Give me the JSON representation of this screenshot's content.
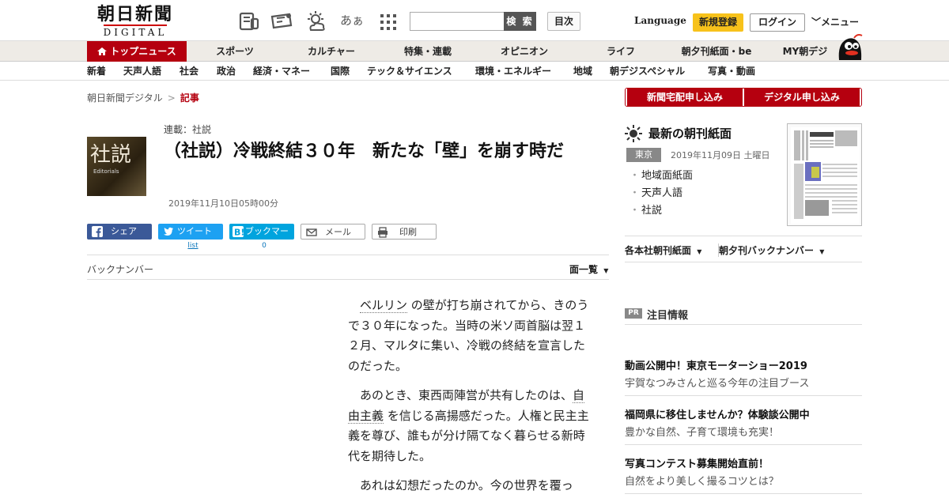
{
  "header": {
    "logo_kanji": "朝日新聞",
    "logo_latin": "DIGITAL",
    "search_button": "検 索",
    "toc_button": "目次",
    "language": "Language",
    "register": "新規登録",
    "login": "ログイン",
    "menu": "メニュー",
    "icons": [
      "newspaper-icon",
      "ticket-icon",
      "weather-icon",
      "font-size-icon",
      "grid-icon"
    ],
    "font_icon_text": "あぁ"
  },
  "nav_primary": [
    "トップニュース",
    "スポーツ",
    "カルチャー",
    "特集・連載",
    "オピニオン",
    "ライフ",
    "朝夕刊紙面・be",
    "MY朝デジ"
  ],
  "nav_secondary": [
    "新着",
    "天声人語",
    "社会",
    "政治",
    "経済・マネー",
    "国際",
    "テック＆サイエンス",
    "環境・エネルギー",
    "地域",
    "朝デジスペシャル",
    "写真・動画"
  ],
  "breadcrumb": {
    "home": "朝日新聞デジタル",
    "separator": ">",
    "current": "記事"
  },
  "article": {
    "thumb_main": "社説",
    "thumb_sub": "Editorials",
    "series": "連載：社説",
    "title": "（社説）冷戦終結３０年　新たな「壁」を崩す時だ",
    "date": "2019年11月10日05時00分",
    "back_number": "バックナンバー",
    "page_list": "面一覧",
    "paragraphs": [
      [
        "",
        "ベルリン",
        " の壁が打ち崩されてから、きのうで３０年になった。当時の米ソ両首脳は翌１２月、マルタに集い、冷戦の終結を宣言したのだった。"
      ],
      [
        "あのとき、東西両陣営が共有したのは、",
        "自由主義",
        " を信じる高揚感だった。人権と民主主義を尊び、誰もが分け隔てなく暮らせる新時代を期待した。"
      ],
      [
        "あれは幻想だったのか。今の世界を覆っ",
        "",
        ""
      ]
    ]
  },
  "share": {
    "facebook": "シェア",
    "twitter": "ツイート",
    "hatena": "ブックマーク",
    "mail": "メール",
    "print": "印刷",
    "twitter_count": "list",
    "hatena_count": "0"
  },
  "sidebar": {
    "subscribe_paper": "新聞宅配申し込み",
    "subscribe_digital": "デジタル申し込み",
    "latest_title": "最新の朝刊紙面",
    "region": "東京",
    "paper_date": "2019年11月09日 土曜日",
    "paper_links": [
      "地域面紙面",
      "天声人語",
      "社説"
    ],
    "dropdowns": [
      "各本社朝刊紙面",
      "朝夕刊バックナンバー"
    ],
    "pr_badge": "PR",
    "notice_title": "注目情報",
    "pr_items": [
      {
        "title": "動画公開中！東京モーターショー2019",
        "sub": "宇賀なつみさんと巡る今年の注目ブース"
      },
      {
        "title": "福岡県に移住しませんか？体験談公開中",
        "sub": "豊かな自然、子育て環境も充実！"
      },
      {
        "title": "写真コンテスト募集開始直前！",
        "sub": "自然をより美しく撮るコツとは？"
      }
    ]
  },
  "colors": {
    "brand_red": "#b5000f",
    "register_yellow": "#f7c21b",
    "facebook": "#3b5998",
    "twitter": "#1da1f2",
    "hatena": "#00a4de"
  }
}
